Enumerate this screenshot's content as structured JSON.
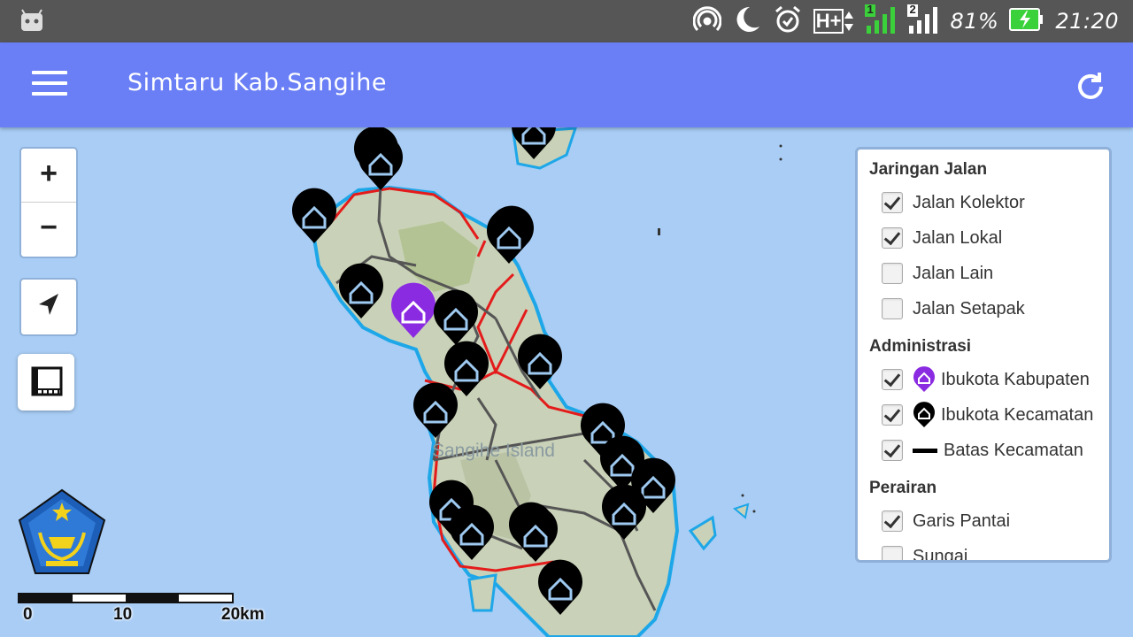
{
  "status_bar": {
    "battery": "81%",
    "time": "21:20",
    "network": "H+",
    "sim1": "1",
    "sim2": "2"
  },
  "app_bar": {
    "title": "Simtaru Kab.Sangihe"
  },
  "map": {
    "island_label": "Sangihe Island",
    "zoom_in_label": "+",
    "zoom_out_label": "−",
    "scale_labels": [
      "0",
      "10",
      "20km"
    ]
  },
  "layers": {
    "groups": [
      {
        "title": "Jaringan Jalan",
        "items": [
          {
            "label": "Jalan Kolektor",
            "checked": true
          },
          {
            "label": "Jalan Lokal",
            "checked": true
          },
          {
            "label": "Jalan Lain",
            "checked": false
          },
          {
            "label": "Jalan Setapak",
            "checked": false
          }
        ]
      },
      {
        "title": "Administrasi",
        "items": [
          {
            "label": "Ibukota Kabupaten",
            "checked": true,
            "icon": "purple-house-pin-icon"
          },
          {
            "label": "Ibukota Kecamatan",
            "checked": true,
            "icon": "black-house-pin-icon"
          },
          {
            "label": "Batas Kecamatan",
            "checked": true,
            "icon": "black-line-icon"
          }
        ]
      },
      {
        "title": "Perairan",
        "items": [
          {
            "label": "Garis Pantai",
            "checked": true
          },
          {
            "label": "Sungai",
            "checked": false
          }
        ]
      }
    ]
  },
  "colors": {
    "app_bar": "#6a7ff5",
    "status_bar": "#565656",
    "water": "#a9cdf5",
    "land": "#c9d2b8",
    "coastline": "#1ea7e8",
    "district_border": "#e41b1b",
    "kabupaten_pin": "#8a2be2",
    "kecamatan_pin": "#000000"
  }
}
